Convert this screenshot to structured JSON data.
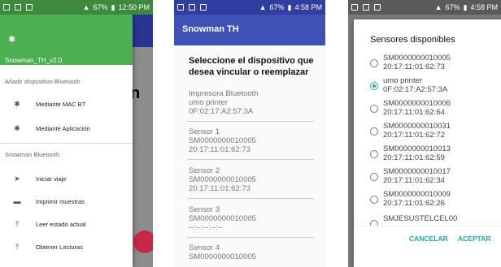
{
  "screen1": {
    "status": {
      "time": "12:50 PM",
      "battery": "67%"
    },
    "drawer_header_name": "Snowman_TH_v2.0",
    "section_bt": "Añadir dispositivo Bluetooth",
    "items_bt": [
      {
        "label": "Mediante MAC BT",
        "icon": "bluetooth-icon"
      },
      {
        "label": "Mediante Aplicación",
        "icon": "bluetooth-icon"
      }
    ],
    "section_snowman": "Snowman Bluetooth",
    "items_snowman": [
      {
        "label": "Iniciar viaje",
        "icon": "send-icon"
      },
      {
        "label": "Imprimir muestras",
        "icon": "print-icon"
      },
      {
        "label": "Leer estado actual",
        "icon": "upload-icon"
      },
      {
        "label": "Obtener Lecturas",
        "icon": "upload-icon"
      }
    ],
    "background_text": "n"
  },
  "screen2": {
    "status": {
      "time": "4:58 PM",
      "battery": "67%"
    },
    "app_title": "Snowman TH",
    "heading": "Seleccione el dispositivo que desea vincular o reemplazar",
    "devices": [
      {
        "line1": "Impresora Bluetooth",
        "line2": "umo printer",
        "line3": "0F:02:17:A2:57:3A"
      },
      {
        "line1": "Sensor 1",
        "line2": "SM0000000010005",
        "line3": "20:17:11:01:62:73"
      },
      {
        "line1": "Sensor 2",
        "line2": "SM0000000010005",
        "line3": "20:17:11:01:62:73"
      },
      {
        "line1": "Sensor 3",
        "line2": "SM0000000010005",
        "line3": "--:--:--:--:--"
      },
      {
        "line1": "Sensor 4",
        "line2": "SM0000000010005",
        "line3": ""
      }
    ]
  },
  "screen3": {
    "status": {
      "time": "4:58 PM",
      "battery": "67%"
    },
    "dialog_title": "Sensores disponibles",
    "options": [
      {
        "name": "SM0000000010005",
        "mac": "20:17:11:01:62:73",
        "selected": false
      },
      {
        "name": "umo printer",
        "mac": "0F:02:17:A2:57:3A",
        "selected": true
      },
      {
        "name": "SM0000000010006",
        "mac": "20:17:11:01:62:64",
        "selected": false
      },
      {
        "name": "SM0000000010031",
        "mac": "20:17:11:01:62:72",
        "selected": false
      },
      {
        "name": "SM0000000010013",
        "mac": "20:17:11:01:62:59",
        "selected": false
      },
      {
        "name": "SM0000000010017",
        "mac": "20:17:11:01:62:34",
        "selected": false
      },
      {
        "name": "SM0000000010009",
        "mac": "20:17:11:01:62:26",
        "selected": false
      },
      {
        "name": "SMJESUSTELCEL00",
        "mac": "",
        "selected": false
      }
    ],
    "cancel_label": "CANCELAR",
    "accept_label": "ACEPTAR"
  },
  "colors": {
    "drawer_header": "#4caf50",
    "appbar": "#3f51b5",
    "accent": "#26a69a",
    "fab": "#c62845"
  }
}
